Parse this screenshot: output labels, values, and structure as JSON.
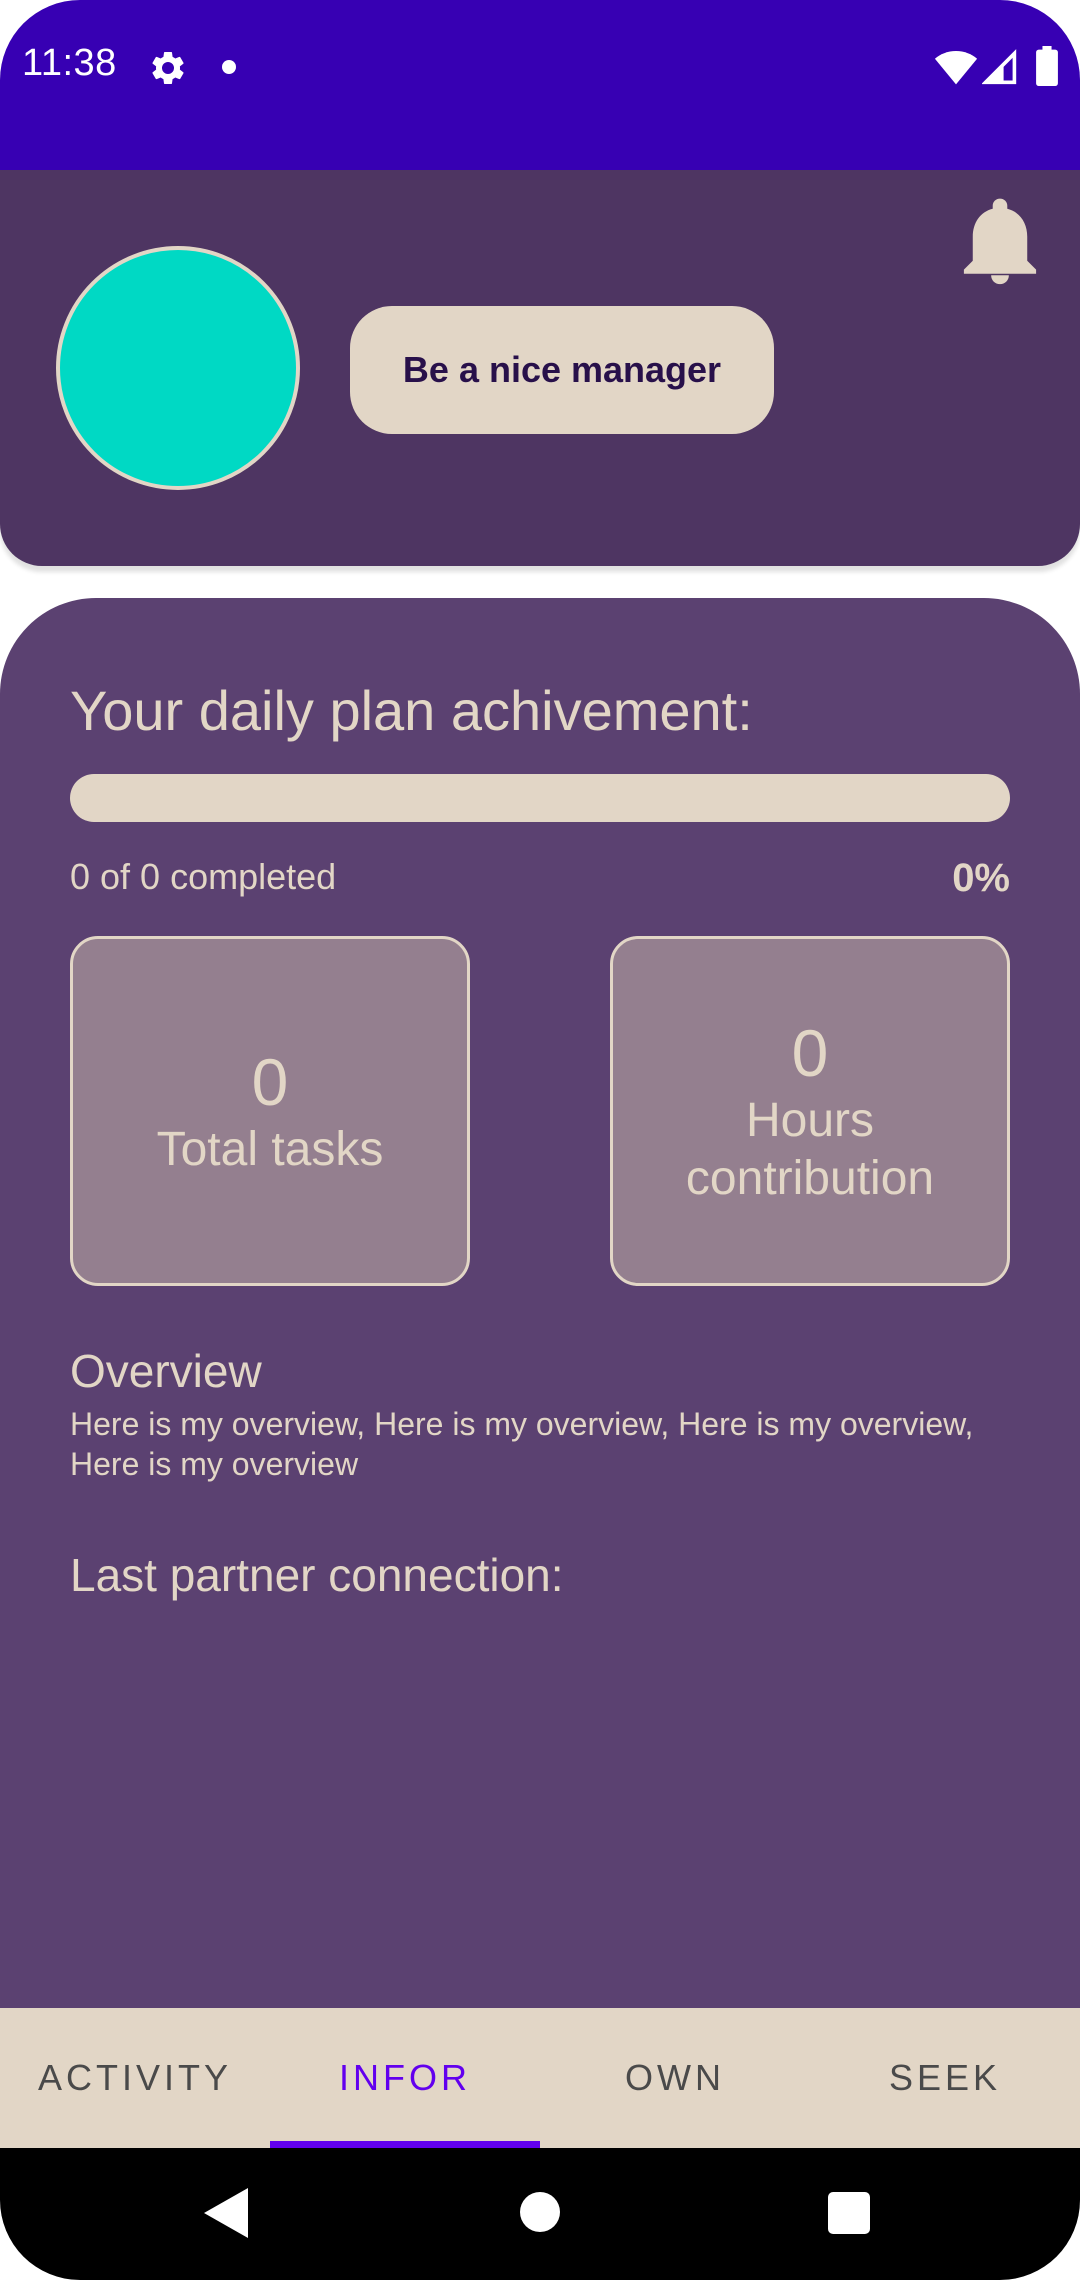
{
  "status_bar": {
    "time": "11:38",
    "icons": [
      "gear-icon",
      "dot-icon",
      "wifi-icon",
      "signal-icon",
      "battery-icon"
    ]
  },
  "header": {
    "avatar_color": "#00d9c4",
    "role_button_label": "Be a nice manager",
    "notification_icon": "bell-icon"
  },
  "plan": {
    "title": "Your daily plan achivement:",
    "progress_fraction": 0,
    "completed_text": "0 of 0 completed",
    "percent": "0%"
  },
  "stats": {
    "total_tasks": {
      "value": "0",
      "label": "Total tasks"
    },
    "hours": {
      "value": "0",
      "label_line1": "Hours",
      "label_line2": "contribution"
    }
  },
  "overview": {
    "title": "Overview",
    "text": "Here is my overview, Here is my overview, Here is my overview, Here is my overview"
  },
  "partner": {
    "title": "Last partner connection:"
  },
  "tabs": [
    {
      "label": "ACTIVITY",
      "active": false
    },
    {
      "label": "INFOR",
      "active": true
    },
    {
      "label": "OWN",
      "active": false
    },
    {
      "label": "SEEK",
      "active": false
    }
  ],
  "nav_bar": {
    "icons": [
      "back-icon",
      "home-icon",
      "recents-icon"
    ]
  },
  "colors": {
    "status_bar": "#3700b3",
    "header_bg": "#4e3562",
    "card_bg": "#5b4171",
    "accent_beige": "#e2d6c6",
    "stat_card_bg": "#947f8f",
    "tab_active": "#6200ee"
  }
}
